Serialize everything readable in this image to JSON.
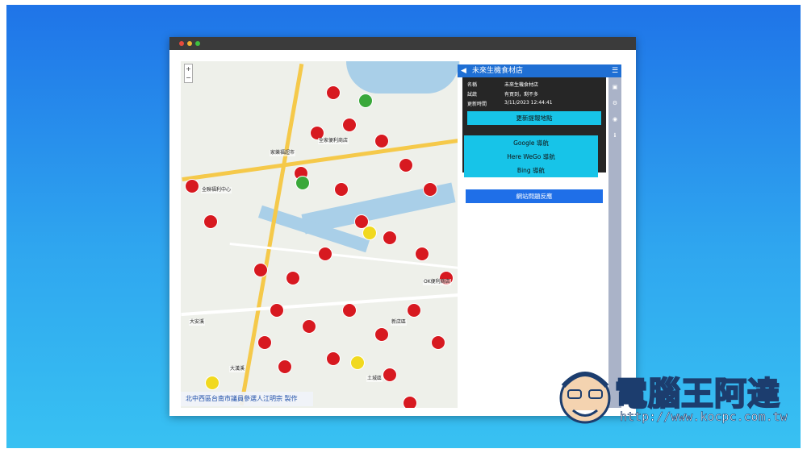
{
  "panel": {
    "title": "未來生機食材店",
    "rows": [
      {
        "key": "名稱",
        "value": "未來生機食材店"
      },
      {
        "key": "試蔬",
        "value": "有買到，剩不多"
      },
      {
        "key": "更新時間",
        "value": "3/11/2023 12:44:41"
      }
    ],
    "update_button": "更新提報地點",
    "nav": [
      "Google 導航",
      "Here WeGo 導航",
      "Bing 導航"
    ],
    "report_button": "網站問題反應"
  },
  "map": {
    "credit": "北中西區台南市議員參選人江明宗 製作",
    "labels": [
      "全聯福利中心",
      "家樂福超市",
      "全家便利商店",
      "大漢溪",
      "土城區",
      "新店區",
      "OK便利商店",
      "大安溪"
    ]
  },
  "logo": {
    "brand": "電腦王阿達",
    "url": "http://www.kocpc.com.tw"
  },
  "colors": {
    "marker_red": "#d71920",
    "marker_green": "#3aa83a",
    "marker_yellow": "#f1d91f",
    "header_blue": "#1f6fd4",
    "button_cyan": "#17c4e8"
  }
}
